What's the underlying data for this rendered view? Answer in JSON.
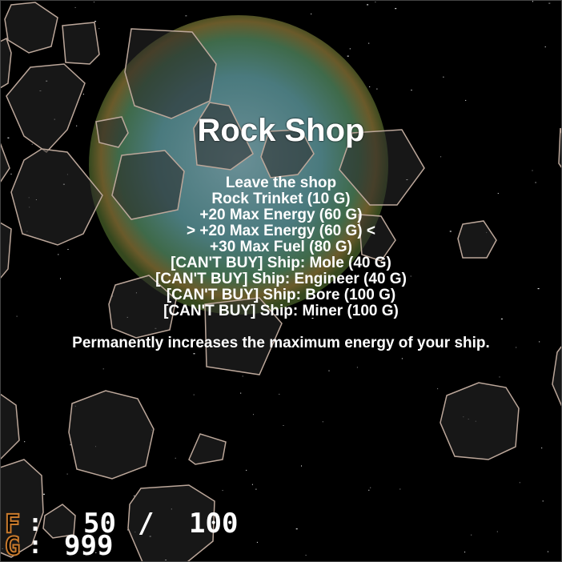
{
  "colors": {
    "background": "#000000",
    "planet_core": "#3f6f73",
    "planet_edge": "#2f5a3a",
    "planet_glow": "#7a5a2a",
    "asteroid_fill": "#2a2a2a",
    "asteroid_stroke": "#bca79a",
    "text": "#ffffff",
    "hud_label": "#c97a2c"
  },
  "shop": {
    "title": "Rock Shop",
    "selected_index": 3,
    "items": [
      {
        "label": "Leave the shop"
      },
      {
        "label": "Rock Trinket (10 G)"
      },
      {
        "label": "+20 Max Energy (60 G)"
      },
      {
        "label": "> +20 Max Energy (60 G) <"
      },
      {
        "label": "+30 Max Fuel (80 G)"
      },
      {
        "label": "[CAN'T BUY] Ship: Mole (40 G)"
      },
      {
        "label": "[CAN'T BUY] Ship: Engineer (40 G)"
      },
      {
        "label": "[CAN'T BUY] Ship: Bore (100 G)"
      },
      {
        "label": "[CAN'T BUY] Ship: Miner (100 G)"
      }
    ],
    "description": "Permanently increases the maximum energy of your ship."
  },
  "hud": {
    "fuel_label": "F",
    "fuel_current": "50",
    "fuel_separator": "/",
    "fuel_max": "100",
    "gold_label": "G",
    "gold_value": "999"
  }
}
